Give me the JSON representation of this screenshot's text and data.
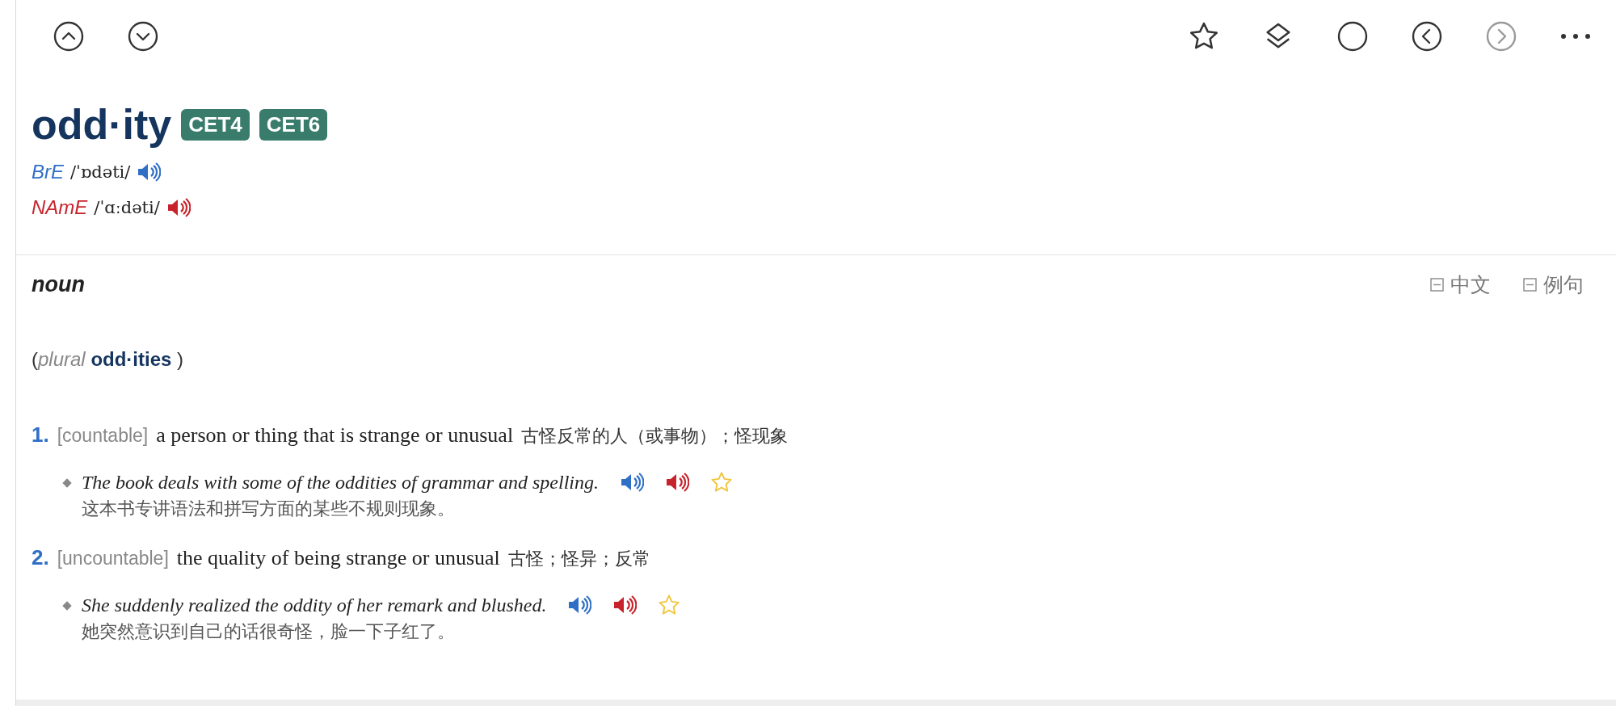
{
  "toolbar": {
    "forward_disabled": true
  },
  "entry": {
    "headword": "odd·ity",
    "levels": [
      "CET4",
      "CET6"
    ],
    "pronunciations": [
      {
        "variety": "BrE",
        "ipa": "/ˈɒdəti/",
        "color": "#2f6fc6"
      },
      {
        "variety": "NAmE",
        "ipa": "/ˈɑːdəti/",
        "color": "#c8232c"
      }
    ]
  },
  "section": {
    "pos": "noun",
    "toggles": [
      {
        "label": "中文",
        "expanded": true
      },
      {
        "label": "例句",
        "expanded": true
      }
    ],
    "plural": "(*plural* **odd·ities** )",
    "senses": [
      {
        "number": "1.",
        "grammar": "[countable]",
        "definition": "a person or thing that is strange or unusual",
        "translation": "古怪反常的人（或事物）；怪现象",
        "examples": [
          {
            "text": "The book deals with some of the oddities of grammar and spelling.",
            "translation": "这本书专讲语法和拼写方面的某些不规则现象。",
            "starred": false
          }
        ]
      },
      {
        "number": "2.",
        "grammar": "[uncountable]",
        "definition": "the quality of being strange or unusual",
        "translation": "古怪；怪异；反常",
        "examples": [
          {
            "text": "She suddenly realized the oddity of her remark and blushed.",
            "translation": "她突然意识到自己的话很奇怪，脸一下子红了。",
            "starred": false
          }
        ]
      }
    ]
  }
}
